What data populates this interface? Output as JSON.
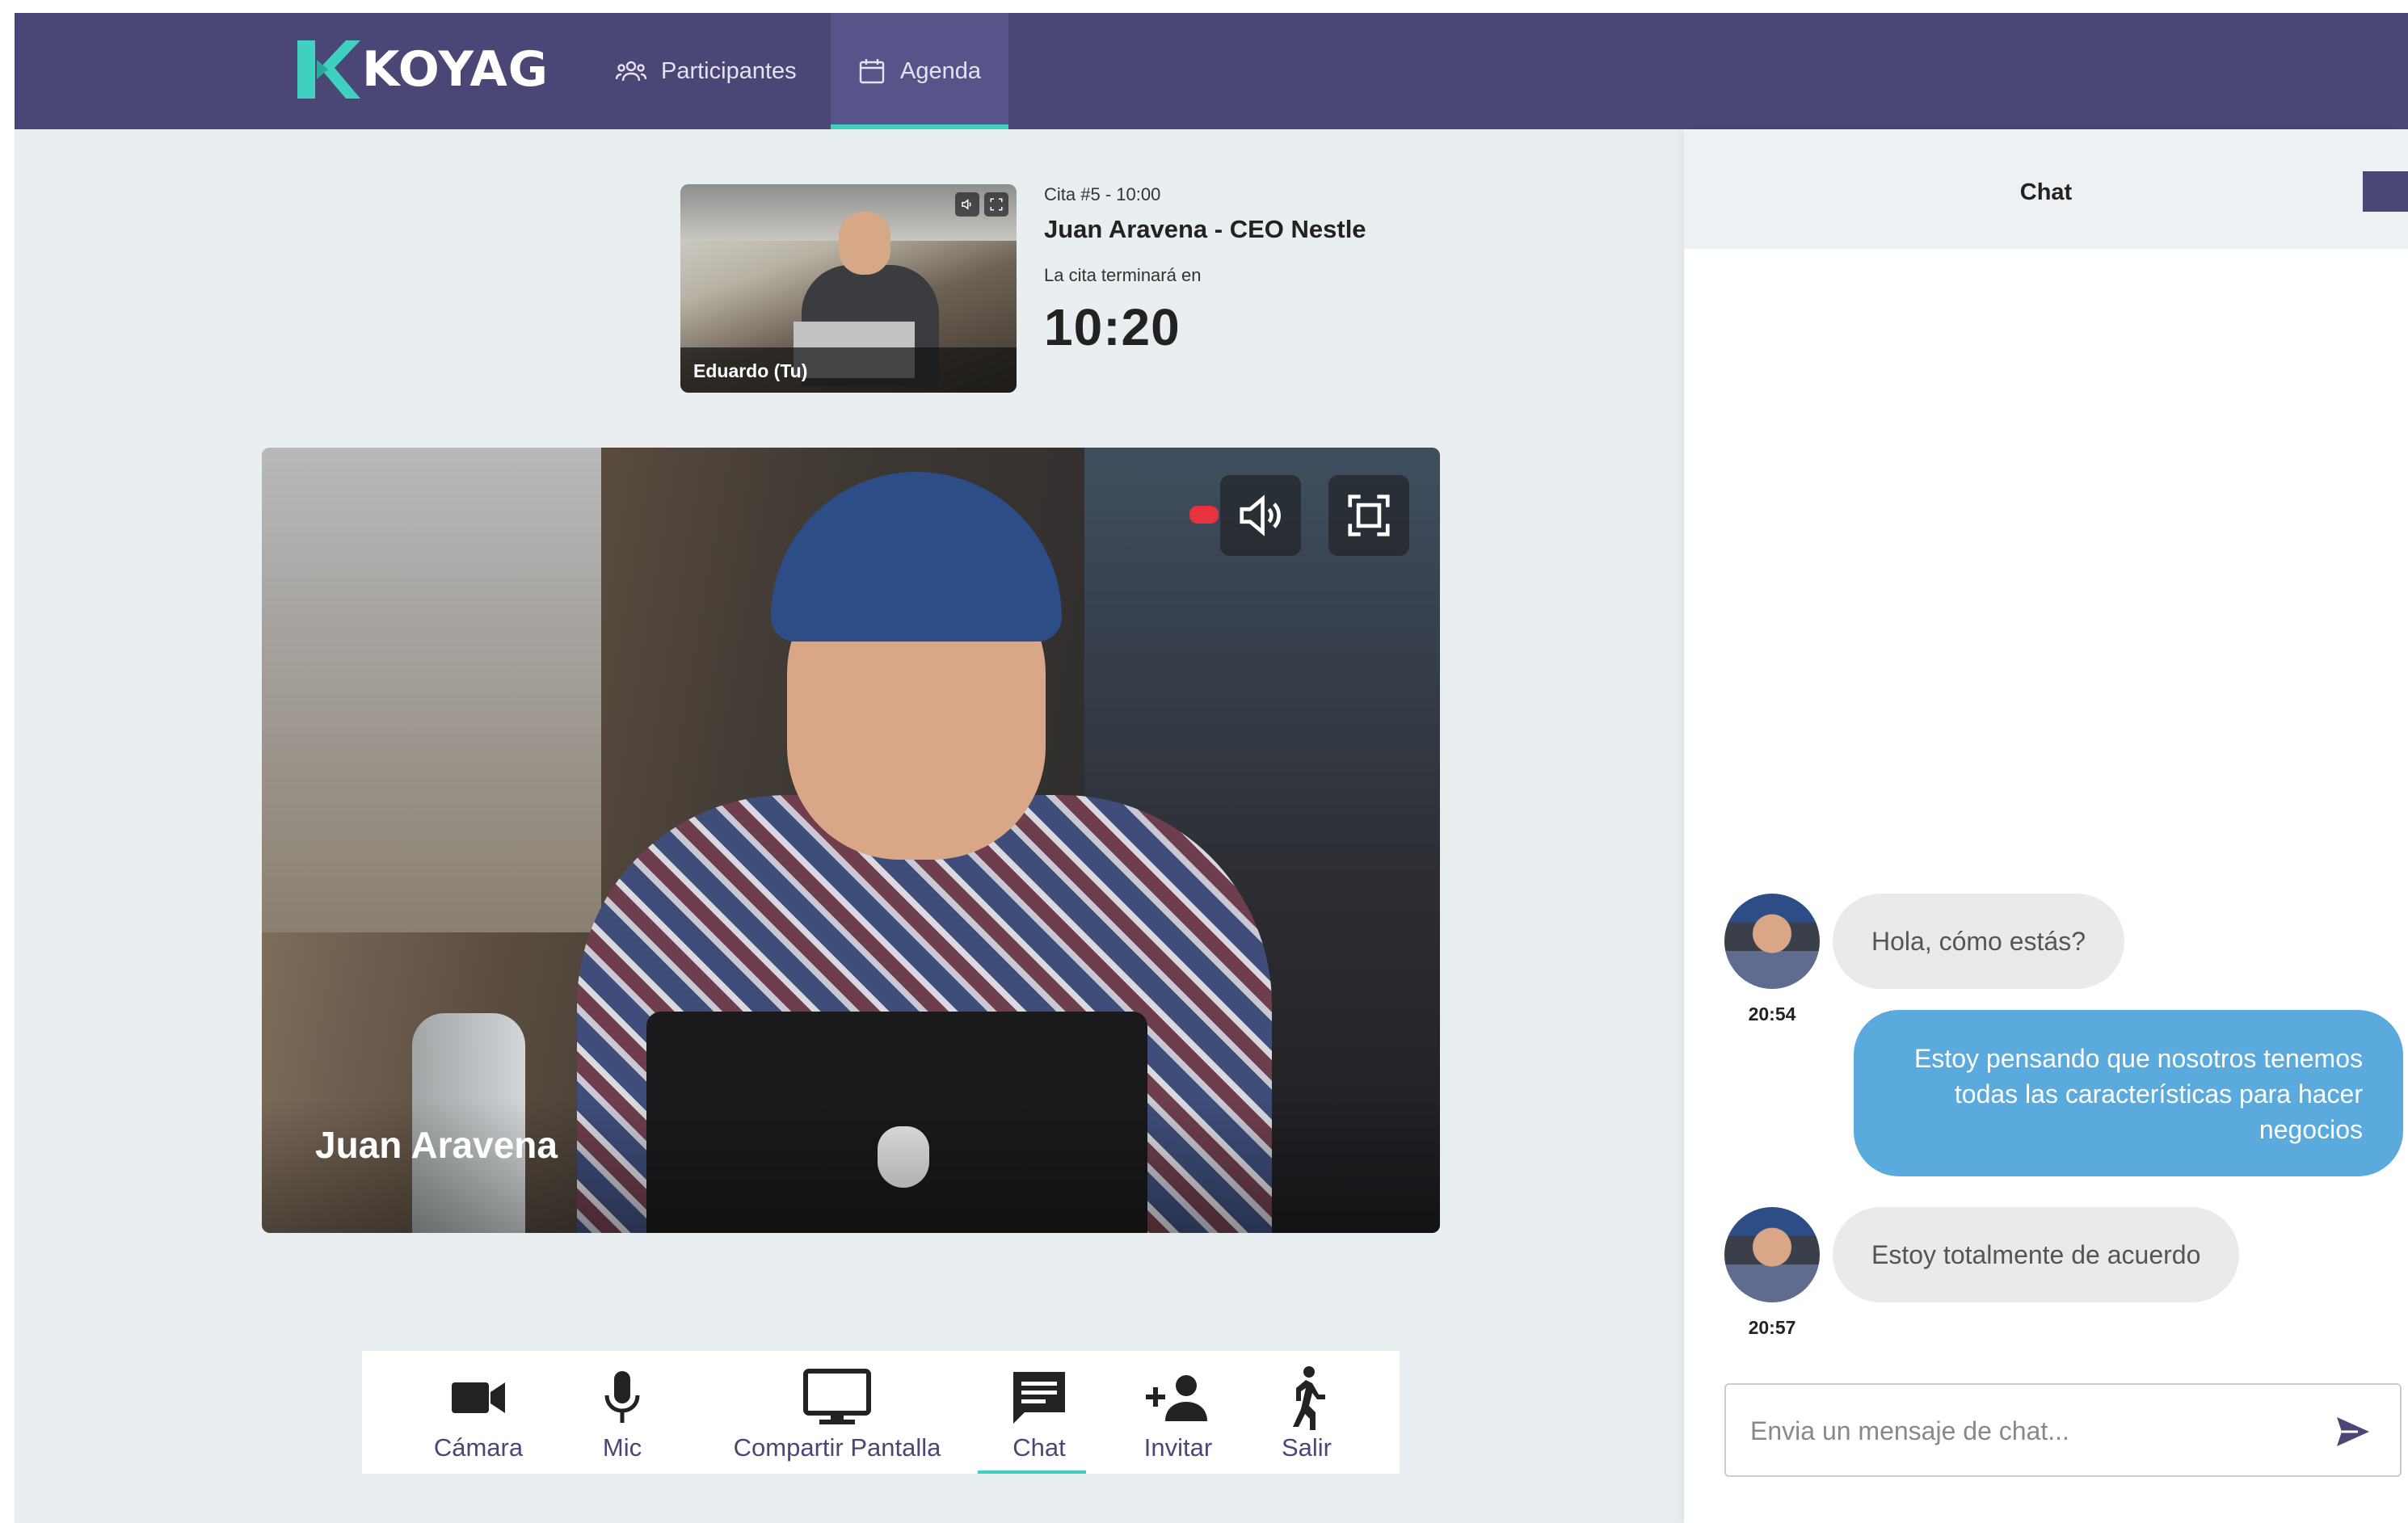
{
  "brand": {
    "name": "KOYAG",
    "accent": "#3fd0c0",
    "nav_bg": "#4a4676"
  },
  "nav": {
    "participantes": "Participantes",
    "agenda": "Agenda"
  },
  "self_preview": {
    "name": "Eduardo (Tu)"
  },
  "appointment": {
    "label": "Cita #5 - 10:00",
    "title": "Juan Aravena - CEO Nestle",
    "ends_in": "La cita terminará en",
    "timer": "10:20"
  },
  "main_video": {
    "name": "Juan Aravena"
  },
  "toolbar": {
    "camara": "Cámara",
    "mic": "Mic",
    "share": "Compartir Pantalla",
    "chat": "Chat",
    "invitar": "Invitar",
    "salir": "Salir"
  },
  "chat": {
    "title": "Chat",
    "messages": [
      {
        "direction": "in",
        "text": "Hola, cómo estás?",
        "time": "20:54"
      },
      {
        "direction": "out",
        "text": "Estoy pensando que nosotros tenemos todas las características para hacer negocios"
      },
      {
        "direction": "in",
        "text": "Estoy totalmente de acuerdo",
        "time": "20:57"
      }
    ],
    "input_placeholder": "Envia un mensaje de chat..."
  }
}
